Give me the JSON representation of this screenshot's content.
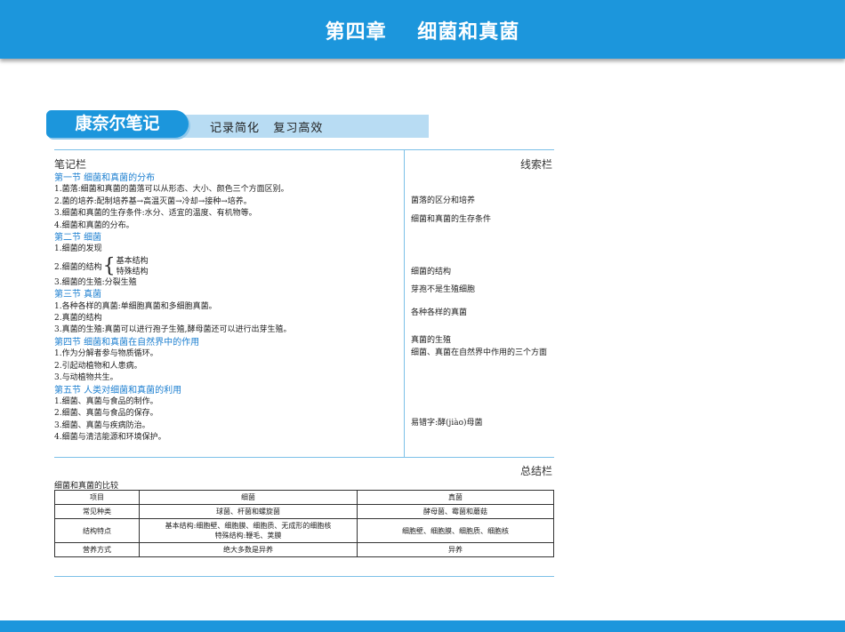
{
  "header": {
    "title": "第四章    细菌和真菌"
  },
  "banner": {
    "tag": "康奈尔笔记",
    "subtitle": "记录简化   复习高效"
  },
  "labels": {
    "notes": "笔记栏",
    "cues": "线索栏",
    "summary": "总结栏"
  },
  "notes": {
    "s1": {
      "title": "第一节    细菌和真菌的分布",
      "l1": "1.菌落:细菌和真菌的菌落可以从形态、大小、颜色三个方面区别。",
      "l2": "2.菌的培养:配制培养基→高温灭菌→冷却→接种→培养。",
      "l3": "3.细菌和真菌的生存条件:水分、适宜的温度、有机物等。",
      "l4": "4.细菌和真菌的分布。"
    },
    "s2": {
      "title": "第二节    细菌",
      "l1": "1.细菌的发现",
      "l2": "2.细菌的结构",
      "l2a": "基本结构",
      "l2b": "特殊结构",
      "l3": "3.细菌的生殖:分裂生殖"
    },
    "s3": {
      "title": "第三节    真菌",
      "l1": "1.各种各样的真菌:单细胞真菌和多细胞真菌。",
      "l2": "2.真菌的结构",
      "l3": "3.真菌的生殖:真菌可以进行孢子生殖,酵母菌还可以进行出芽生殖。"
    },
    "s4": {
      "title": "第四节    细菌和真菌在自然界中的作用",
      "l1": "1.作为分解者参与物质循环。",
      "l2": "2.引起动植物和人患病。",
      "l3": "3.与动植物共生。"
    },
    "s5": {
      "title": "第五节    人类对细菌和真菌的利用",
      "l1": "1.细菌、真菌与食品的制作。",
      "l2": "2.细菌、真菌与食品的保存。",
      "l3": "3.细菌、真菌与疾病防治。",
      "l4": "4.细菌与清洁能源和环境保护。"
    }
  },
  "cues": {
    "c1": "菌落的区分和培养",
    "c2": "细菌和真菌的生存条件",
    "c3": "细菌的结构",
    "c4": "芽孢不是生殖细胞",
    "c5": "各种各样的真菌",
    "c6": "真菌的生殖",
    "c7": "细菌、真菌在自然界中作用的三个方面",
    "c8": "易错字:酵(jiào)母菌"
  },
  "comparison": {
    "title": "细菌和真菌的比较",
    "headers": [
      "项目",
      "细菌",
      "真菌"
    ],
    "rows": [
      [
        "常见种类",
        "球菌、杆菌和螺旋菌",
        "酵母菌、霉菌和蘑菇"
      ],
      [
        "结构特点",
        "基本结构:细胞壁、细胞膜、细胞质、无成形的细胞核\n特殊结构:鞭毛、荚膜",
        "细胞壁、细胞膜、细胞质、细胞核"
      ],
      [
        "营养方式",
        "绝大多数是异养",
        "异养"
      ]
    ]
  }
}
